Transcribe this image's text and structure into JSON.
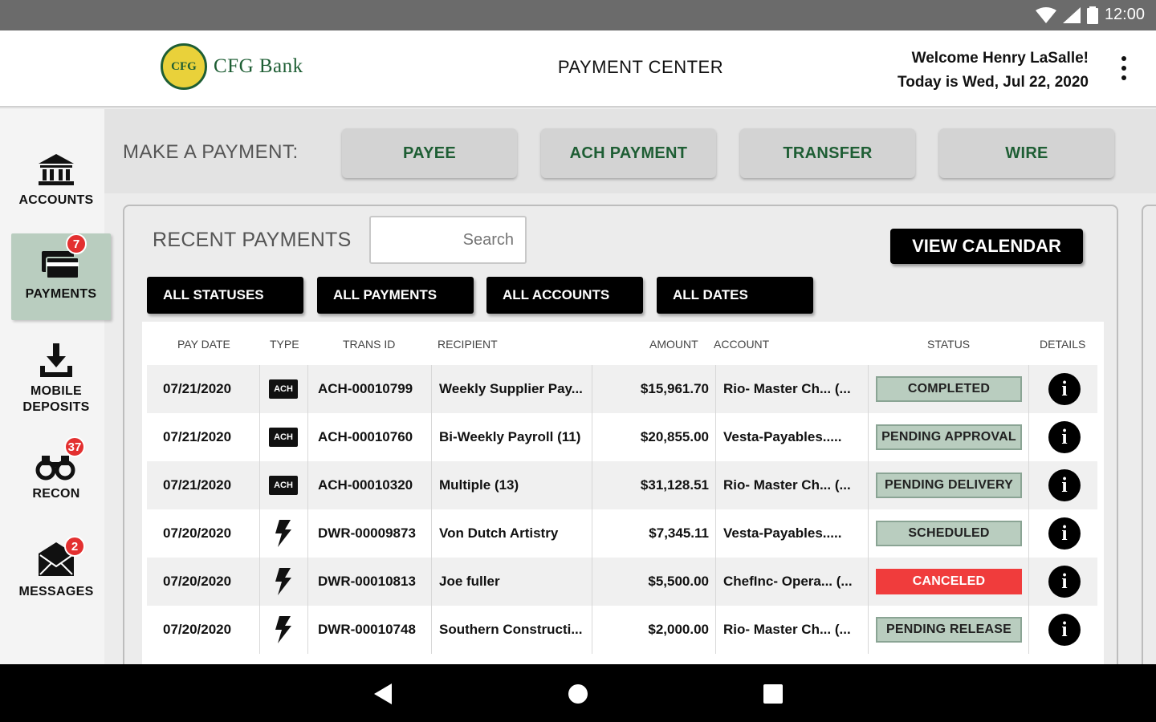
{
  "status_bar": {
    "time": "12:00"
  },
  "header": {
    "logo_text": "CFG Bank",
    "logo_badge": "CFG",
    "title": "PAYMENT CENTER",
    "welcome": "Welcome Henry LaSalle!",
    "date": "Today is Wed, Jul 22, 2020"
  },
  "sidebar": {
    "items": [
      {
        "label": "ACCOUNTS",
        "icon": "bank-icon",
        "badge": null
      },
      {
        "label": "PAYMENTS",
        "icon": "payments-card-icon",
        "badge": "7"
      },
      {
        "label": "MOBILE",
        "label2": "DEPOSITS",
        "icon": "download-tray-icon",
        "badge": null
      },
      {
        "label": "RECON",
        "icon": "binoculars-icon",
        "badge": "37"
      },
      {
        "label": "MESSAGES",
        "icon": "envelope-icon",
        "badge": "2"
      }
    ]
  },
  "make_payment": {
    "label": "MAKE A PAYMENT:",
    "buttons": [
      "PAYEE",
      "ACH PAYMENT",
      "TRANSFER",
      "WIRE"
    ]
  },
  "recent": {
    "title": "RECENT PAYMENTS",
    "search_placeholder": "Search",
    "view_calendar": "VIEW CALENDAR",
    "filters": [
      "ALL STATUSES",
      "ALL PAYMENTS",
      "ALL ACCOUNTS",
      "ALL DATES"
    ]
  },
  "table": {
    "headers": [
      "PAY DATE",
      "TYPE",
      "TRANS ID",
      "RECIPIENT",
      "AMOUNT",
      "ACCOUNT",
      "STATUS",
      "DETAILS"
    ],
    "rows": [
      {
        "date": "07/21/2020",
        "type": "ACH",
        "trans_id": "ACH-00010799",
        "recipient": "Weekly Supplier Pay...",
        "amount": "$15,961.70",
        "account": "Rio- Master Ch...  (...",
        "status": "COMPLETED",
        "status_kind": "ok"
      },
      {
        "date": "07/21/2020",
        "type": "ACH",
        "trans_id": "ACH-00010760",
        "recipient": "Bi-Weekly Payroll (11)",
        "amount": "$20,855.00",
        "account": "Vesta-Payables.....",
        "status": "PENDING APPROVAL",
        "status_kind": "ok"
      },
      {
        "date": "07/21/2020",
        "type": "ACH",
        "trans_id": "ACH-00010320",
        "recipient": "Multiple (13)",
        "amount": "$31,128.51",
        "account": "Rio- Master Ch...  (...",
        "status": "PENDING DELIVERY",
        "status_kind": "ok"
      },
      {
        "date": "07/20/2020",
        "type": "WIRE",
        "trans_id": "DWR-00009873",
        "recipient": "Von Dutch Artistry",
        "amount": "$7,345.11",
        "account": "Vesta-Payables.....",
        "status": "SCHEDULED",
        "status_kind": "ok"
      },
      {
        "date": "07/20/2020",
        "type": "WIRE",
        "trans_id": "DWR-00010813",
        "recipient": "Joe fuller",
        "amount": "$5,500.00",
        "account": "ChefInc- Opera...  (...",
        "status": "CANCELED",
        "status_kind": "canceled"
      },
      {
        "date": "07/20/2020",
        "type": "WIRE",
        "trans_id": "DWR-00010748",
        "recipient": "Southern Constructi...",
        "amount": "$2,000.00",
        "account": "Rio- Master Ch...  (...",
        "status": "PENDING RELEASE",
        "status_kind": "ok"
      }
    ]
  },
  "colors": {
    "brand_green": "#1e5e34",
    "status_ok": "#b9cdbf",
    "status_canceled": "#f03c3c",
    "badge_red": "#e33030"
  }
}
